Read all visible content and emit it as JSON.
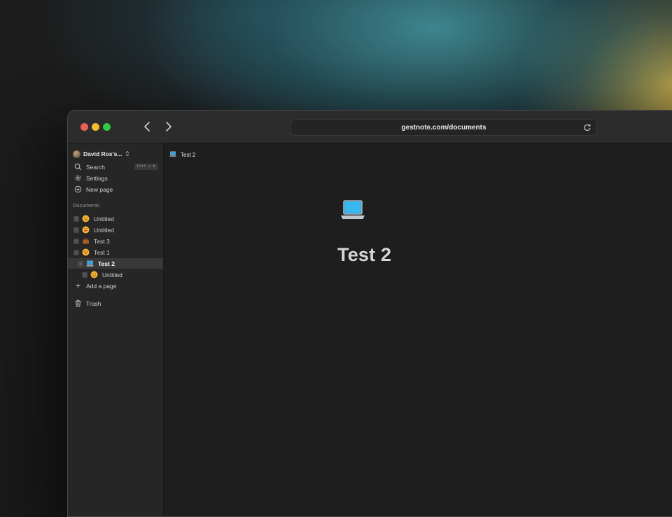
{
  "browser": {
    "url": "gestnote.com/documents"
  },
  "sidebar": {
    "workspace_name": "David Ros's...",
    "search_label": "Search",
    "search_shortcut": "Ctrl + K",
    "settings_label": "Settings",
    "new_page_label": "New page",
    "documents_heading": "Documents",
    "documents": [
      {
        "title": "Untitled",
        "emoji": "smiling-face",
        "expanded": false
      },
      {
        "title": "Untitled",
        "emoji": "grinning-face",
        "expanded": false
      },
      {
        "title": "Test 3",
        "emoji": "briefcase",
        "expanded": false
      },
      {
        "title": "Test 1",
        "emoji": "grinning-face",
        "expanded": true
      },
      {
        "title": "Test 2",
        "emoji": "laptop",
        "expanded": true,
        "active": true
      },
      {
        "title": "Untitled",
        "emoji": "smiling-face",
        "expanded": false
      }
    ],
    "add_page_label": "Add a page",
    "trash_label": "Trash"
  },
  "main": {
    "breadcrumb_title": "Test 2",
    "page_emoji": "laptop",
    "page_title": "Test 2"
  },
  "colors": {
    "accent_red": "#ee5f57",
    "accent_yellow": "#f3bb2f",
    "accent_green": "#2ec940",
    "sidebar_bg": "#262627",
    "main_bg": "#1e1e1e"
  }
}
